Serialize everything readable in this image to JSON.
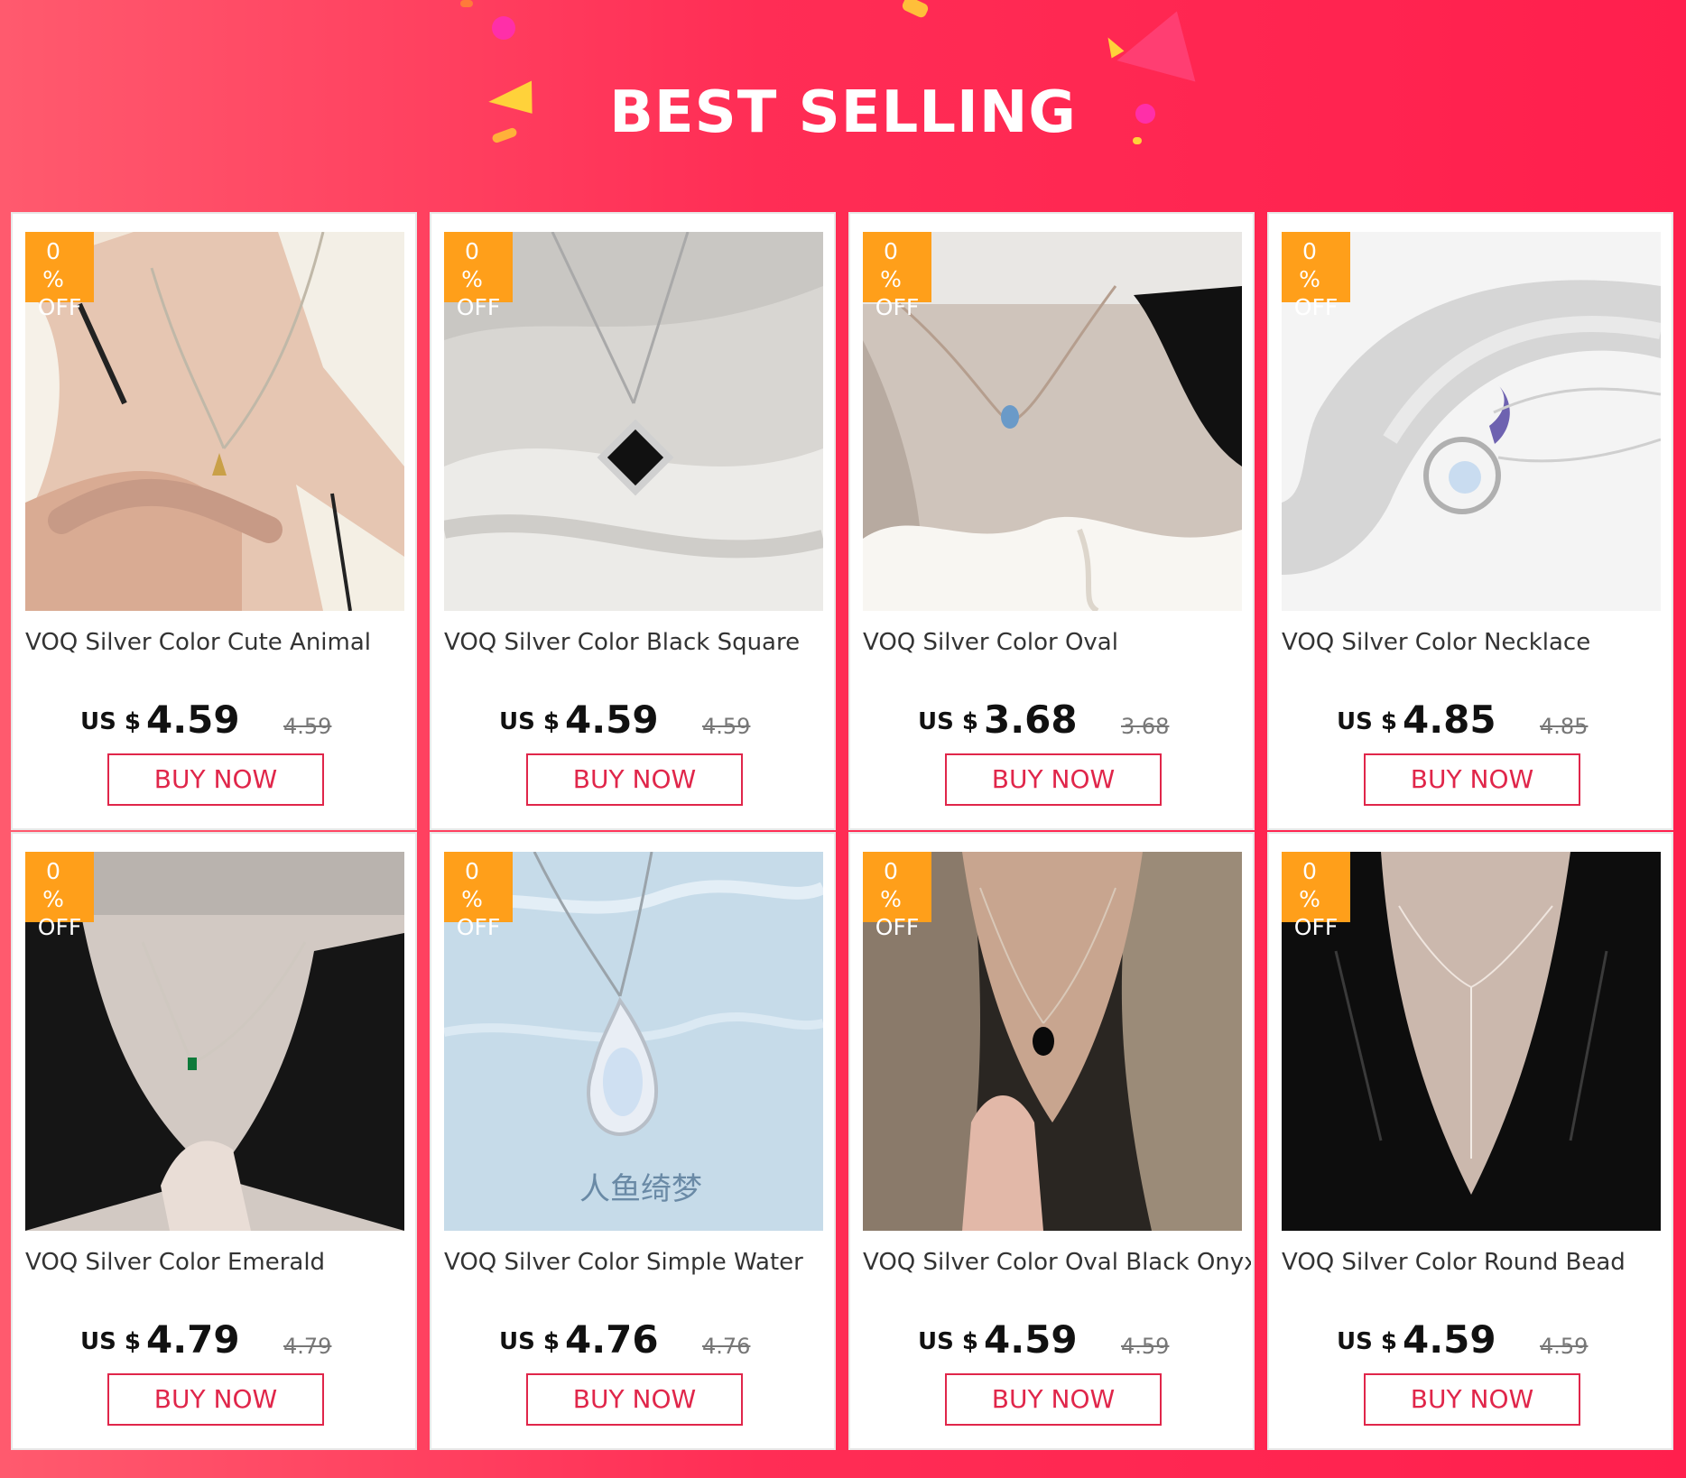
{
  "header": {
    "title": "BEST SELLING"
  },
  "colors": {
    "background": "#ff2d55",
    "accent": "#e0264a",
    "badge": "#ff9f1a"
  },
  "products": [
    {
      "badge_pct": "0 %",
      "badge_off": "OFF",
      "title": "VOQ Silver Color Cute Animal",
      "currency": "US $",
      "price": "4.59",
      "original_price": "4.59",
      "buy_label": "BUY NOW"
    },
    {
      "badge_pct": "0 %",
      "badge_off": "OFF",
      "title": "VOQ Silver Color Black Square",
      "currency": "US $",
      "price": "4.59",
      "original_price": "4.59",
      "buy_label": "BUY NOW"
    },
    {
      "badge_pct": "0 %",
      "badge_off": "OFF",
      "title": "VOQ Silver Color Oval",
      "currency": "US $",
      "price": "3.68",
      "original_price": "3.68",
      "buy_label": "BUY NOW"
    },
    {
      "badge_pct": "0 %",
      "badge_off": "OFF",
      "title": "VOQ Silver Color Necklace",
      "currency": "US $",
      "price": "4.85",
      "original_price": "4.85",
      "buy_label": "BUY NOW"
    },
    {
      "badge_pct": "0 %",
      "badge_off": "OFF",
      "title": "VOQ Silver Color Emerald",
      "currency": "US $",
      "price": "4.79",
      "original_price": "4.79",
      "buy_label": "BUY NOW"
    },
    {
      "badge_pct": "0 %",
      "badge_off": "OFF",
      "title": "VOQ Silver Color Simple Water",
      "currency": "US $",
      "price": "4.76",
      "original_price": "4.76",
      "buy_label": "BUY NOW",
      "image_caption": "人鱼绮梦"
    },
    {
      "badge_pct": "0 %",
      "badge_off": "OFF",
      "title": "VOQ Silver Color Oval Black Onyx",
      "currency": "US $",
      "price": "4.59",
      "original_price": "4.59",
      "buy_label": "BUY NOW"
    },
    {
      "badge_pct": "0 %",
      "badge_off": "OFF",
      "title": "VOQ Silver Color Round Bead",
      "currency": "US $",
      "price": "4.59",
      "original_price": "4.59",
      "buy_label": "BUY NOW"
    }
  ]
}
